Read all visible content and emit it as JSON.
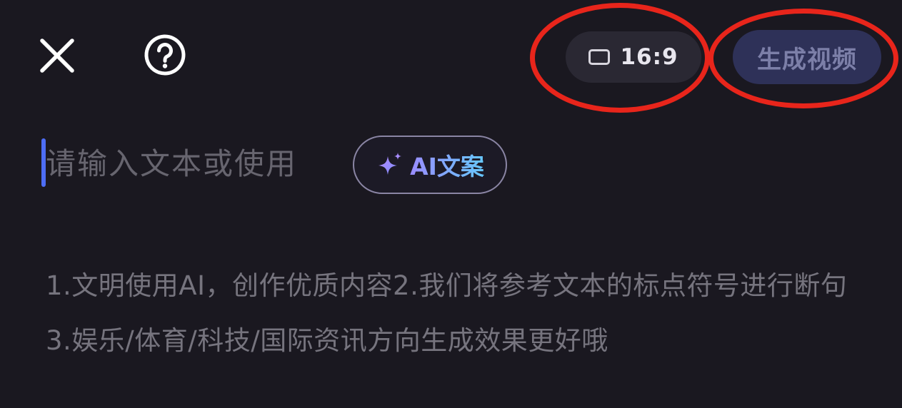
{
  "header": {
    "close_icon": "close-icon",
    "help_icon": "help-circle-icon",
    "aspect_ratio_label": "16:9",
    "aspect_ratio_icon": "rectangle-frame-icon",
    "generate_button_label": "生成视频"
  },
  "editor": {
    "placeholder": "请输入文本或使用",
    "ai_button_label": "AI文案",
    "ai_button_icon": "sparkle-icon",
    "hint_text": "1.文明使用AI，创作优质内容2.我们将参考文本的标点符号进行断句3.娱乐/体育/科技/国际资讯方向生成效果更好哦"
  },
  "colors": {
    "background": "#1a1820",
    "highlight_ring": "#e8251b",
    "generate_button_bg": "#2e3158",
    "cursor": "#4d6df5"
  }
}
